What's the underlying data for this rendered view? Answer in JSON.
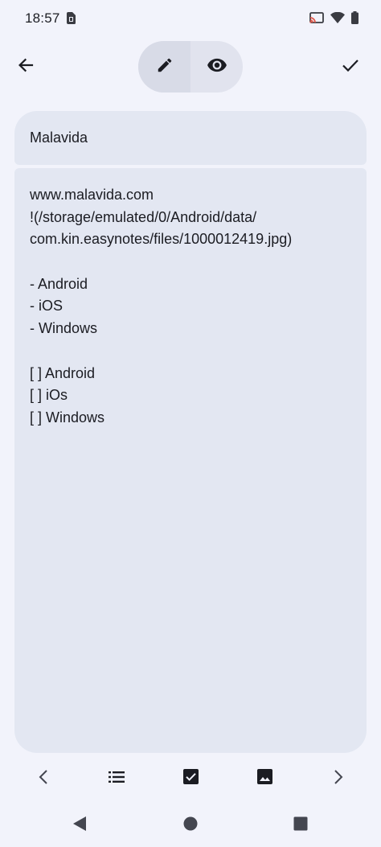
{
  "status_bar": {
    "time": "18:57",
    "icons": [
      "sim-card-icon",
      "cast-icon",
      "wifi-icon",
      "battery-icon"
    ]
  },
  "top_bar": {
    "back_icon": "arrow-back-icon",
    "edit_icon": "pencil-icon",
    "view_icon": "eye-icon",
    "save_icon": "check-icon",
    "active_mode": "edit"
  },
  "note": {
    "title": "Malavida",
    "lines": [
      "www.malavida.com",
      "!(/storage/emulated/0/Android/data/",
      "com.kin.easynotes/files/1000012419.jpg)",
      "",
      "- Android",
      "- iOS",
      "- Windows",
      "",
      "[ ] Android",
      "[ ] iOs",
      "[ ] Windows"
    ]
  },
  "toolbar": {
    "items": [
      "chevron-left-icon",
      "bulleted-list-icon",
      "checkbox-icon",
      "image-icon",
      "chevron-right-icon"
    ]
  },
  "nav_bar": {
    "items": [
      "nav-back-icon",
      "nav-home-icon",
      "nav-recents-icon"
    ]
  },
  "colors": {
    "background": "#f2f3fb",
    "field": "#e3e7f2",
    "toggle": "#e1e3ee",
    "toggle_active": "#d8dbe7",
    "text": "#1b1c22",
    "icon": "#1b1c22",
    "nav_icon": "#444650"
  }
}
